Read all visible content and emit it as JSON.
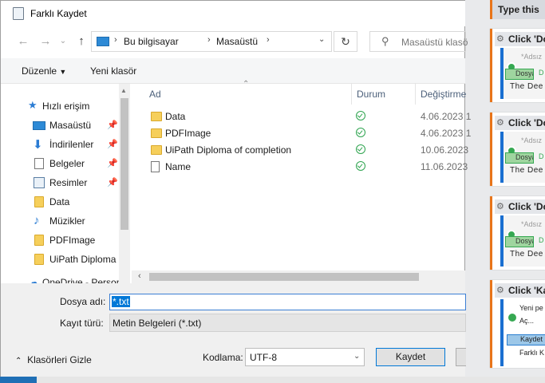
{
  "dialog": {
    "title": "Farklı Kaydet"
  },
  "nav": {
    "address": [
      "Bu bilgisayar",
      "Masaüstü"
    ],
    "search_placeholder": "Masaüstü klasö"
  },
  "toolbar": {
    "organize_label": "Düzenle",
    "new_folder_label": "Yeni klasör"
  },
  "sidebar": {
    "quick_access_label": "Hızlı erişim",
    "items": [
      {
        "label": "Masaüstü",
        "pinned": true,
        "icon": "desktop-icon"
      },
      {
        "label": "İndirilenler",
        "pinned": true,
        "icon": "download-icon"
      },
      {
        "label": "Belgeler",
        "pinned": true,
        "icon": "documents-icon"
      },
      {
        "label": "Resimler",
        "pinned": true,
        "icon": "pictures-icon"
      },
      {
        "label": "Data",
        "pinned": false,
        "icon": "folder-icon"
      },
      {
        "label": "Müzikler",
        "pinned": false,
        "icon": "music-icon"
      },
      {
        "label": "PDFImage",
        "pinned": false,
        "icon": "folder-icon"
      },
      {
        "label": "UiPath Diploma",
        "pinned": false,
        "icon": "folder-icon"
      },
      {
        "label": "OneDrive - Person",
        "pinned": false,
        "icon": "cloud-icon"
      }
    ]
  },
  "file_list": {
    "columns": [
      "Ad",
      "Durum",
      "Değiştirme"
    ],
    "rows": [
      {
        "name": "Data",
        "type": "folder",
        "date": "4.06.2023 1"
      },
      {
        "name": "PDFImage",
        "type": "folder",
        "date": "4.06.2023 1"
      },
      {
        "name": "UiPath Diploma of completion",
        "type": "folder",
        "date": "10.06.2023"
      },
      {
        "name": "Name",
        "type": "document",
        "date": "11.06.2023"
      }
    ]
  },
  "form": {
    "filename_label": "Dosya adı:",
    "filename_value": "*.txt",
    "filetype_label": "Kayıt türü:",
    "filetype_value": "Metin Belgeleri (*.txt)",
    "encoding_label": "Kodlama:",
    "encoding_value": "UTF-8",
    "hide_folders_label": "Klasörleri Gizle",
    "save_label": "Kaydet"
  },
  "background_panel": {
    "type_this_label": "Type this",
    "activities": [
      {
        "title": "Click 'Do",
        "line1": "*Adsız",
        "sel": "Dosya",
        "sel2": "D",
        "line2": "The Dee"
      },
      {
        "title": "Click 'Do",
        "line1": "*Adsız",
        "sel": "Dosya",
        "sel2": "D",
        "line2": "The Dee"
      },
      {
        "title": "Click 'Do",
        "line1": "*Adsız",
        "sel": "Dosya",
        "sel2": "D",
        "line2": "The Dee"
      },
      {
        "title": "Click 'Ka",
        "menu": [
          "Yeni pe",
          "Aç...",
          "Kaydet",
          "Farklı K"
        ]
      }
    ]
  },
  "colors": {
    "accent": "#0078d7",
    "status_green": "#2ea44f",
    "folder": "#f6cf5b",
    "card_border": "#e8751a"
  }
}
